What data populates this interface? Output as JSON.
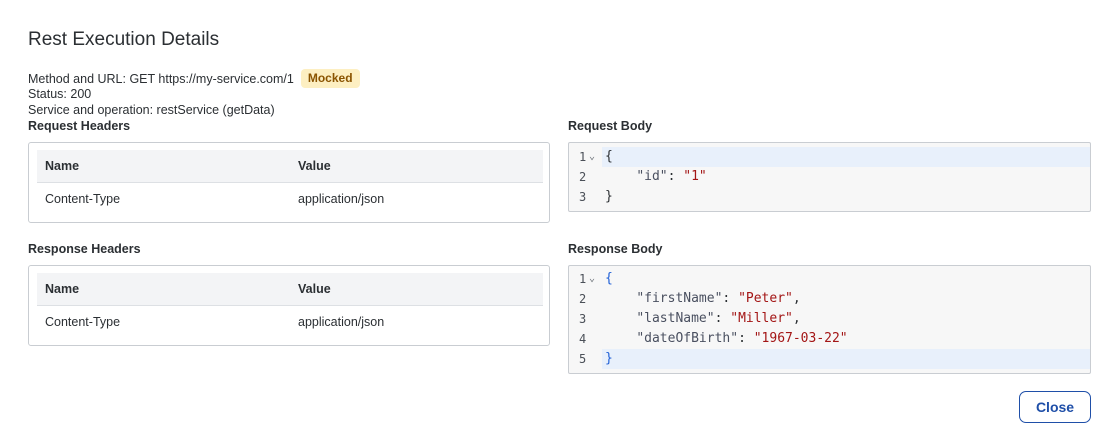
{
  "dialog": {
    "title": "Rest Execution Details",
    "method_url_text": "Method and URL: GET https://my-service.com/1",
    "badge": "Mocked",
    "status_text": "Status: 200",
    "service_text": "Service and operation: restService (getData)",
    "close_label": "Close"
  },
  "request_headers": {
    "label": "Request Headers",
    "columns": [
      "Name",
      "Value"
    ],
    "rows": [
      {
        "name": "Content-Type",
        "value": "application/json"
      }
    ]
  },
  "response_headers": {
    "label": "Response Headers",
    "columns": [
      "Name",
      "Value"
    ],
    "rows": [
      {
        "name": "Content-Type",
        "value": "application/json"
      }
    ]
  },
  "request_body": {
    "label": "Request Body",
    "line_numbers": [
      "1",
      "2",
      "3"
    ],
    "lines": [
      {
        "open": "{"
      },
      {
        "key": "\"id\"",
        "value": "\"1\""
      },
      {
        "close": "}"
      }
    ]
  },
  "response_body": {
    "label": "Response Body",
    "line_numbers": [
      "1",
      "2",
      "3",
      "4",
      "5"
    ],
    "lines": [
      {
        "open": "{"
      },
      {
        "key": "\"firstName\"",
        "value": "\"Peter\""
      },
      {
        "key": "\"lastName\"",
        "value": "\"Miller\""
      },
      {
        "key": "\"dateOfBirth\"",
        "value": "\"1967-03-22\""
      },
      {
        "close": "}"
      }
    ]
  },
  "colors": {
    "accent": "#1f4fa8",
    "badge_bg": "#fdefc2",
    "badge_text": "#8a5300",
    "string": "#a31515",
    "active_line": "#e8f0fb"
  }
}
